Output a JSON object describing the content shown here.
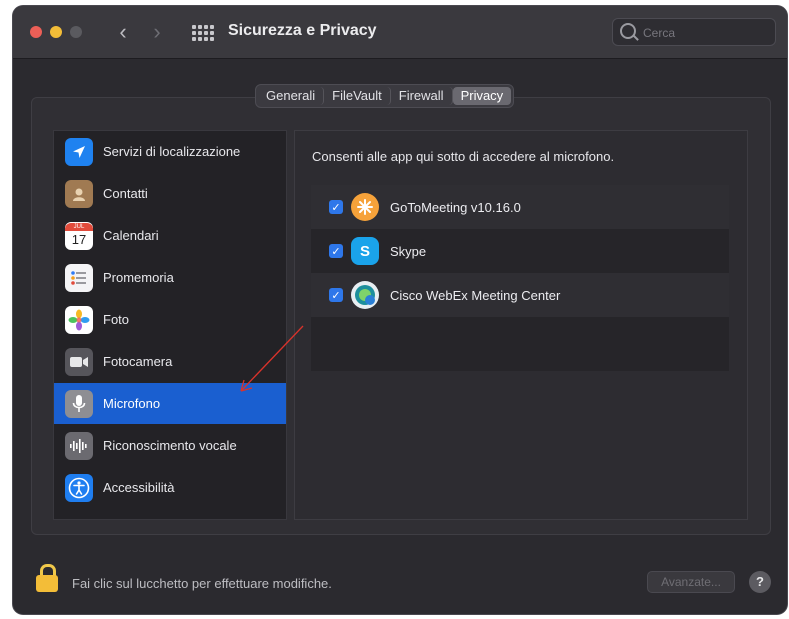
{
  "window": {
    "title": "Sicurezza e Privacy",
    "search": {
      "placeholder": "Cerca"
    }
  },
  "tabs": [
    {
      "label": "Generali",
      "active": false
    },
    {
      "label": "FileVault",
      "active": false
    },
    {
      "label": "Firewall",
      "active": false
    },
    {
      "label": "Privacy",
      "active": true
    }
  ],
  "sidebar": {
    "items": [
      {
        "label": "Servizi di localizzazione",
        "icon": "location-arrow-icon",
        "selected": false
      },
      {
        "label": "Contatti",
        "icon": "contacts-icon",
        "selected": false
      },
      {
        "label": "Calendari",
        "icon": "calendar-icon",
        "icon_text": "17",
        "icon_month": "JUL",
        "selected": false
      },
      {
        "label": "Promemoria",
        "icon": "reminders-icon",
        "selected": false
      },
      {
        "label": "Foto",
        "icon": "photos-icon",
        "selected": false
      },
      {
        "label": "Fotocamera",
        "icon": "camera-icon",
        "selected": false
      },
      {
        "label": "Microfono",
        "icon": "microphone-icon",
        "selected": true
      },
      {
        "label": "Riconoscimento vocale",
        "icon": "speech-recognition-icon",
        "selected": false
      },
      {
        "label": "Accessibilità",
        "icon": "accessibility-icon",
        "selected": false
      }
    ]
  },
  "content": {
    "heading": "Consenti alle app qui sotto di accedere al microfono.",
    "apps": [
      {
        "name": "GoToMeeting v10.16.0",
        "checked": true,
        "icon": "gotomeeting-icon"
      },
      {
        "name": "Skype",
        "checked": true,
        "icon": "skype-icon",
        "icon_text": "S"
      },
      {
        "name": "Cisco WebEx Meeting Center",
        "checked": true,
        "icon": "webex-icon"
      }
    ]
  },
  "footer": {
    "lock_text": "Fai clic sul lucchetto per effettuare modifiche.",
    "advanced_label": "Avanzate...",
    "help_label": "?"
  },
  "colors": {
    "selection": "#1a5fd0",
    "checkbox": "#2e77ea",
    "annotation_arrow": "#d9332b",
    "lock": "#f3bd38"
  }
}
